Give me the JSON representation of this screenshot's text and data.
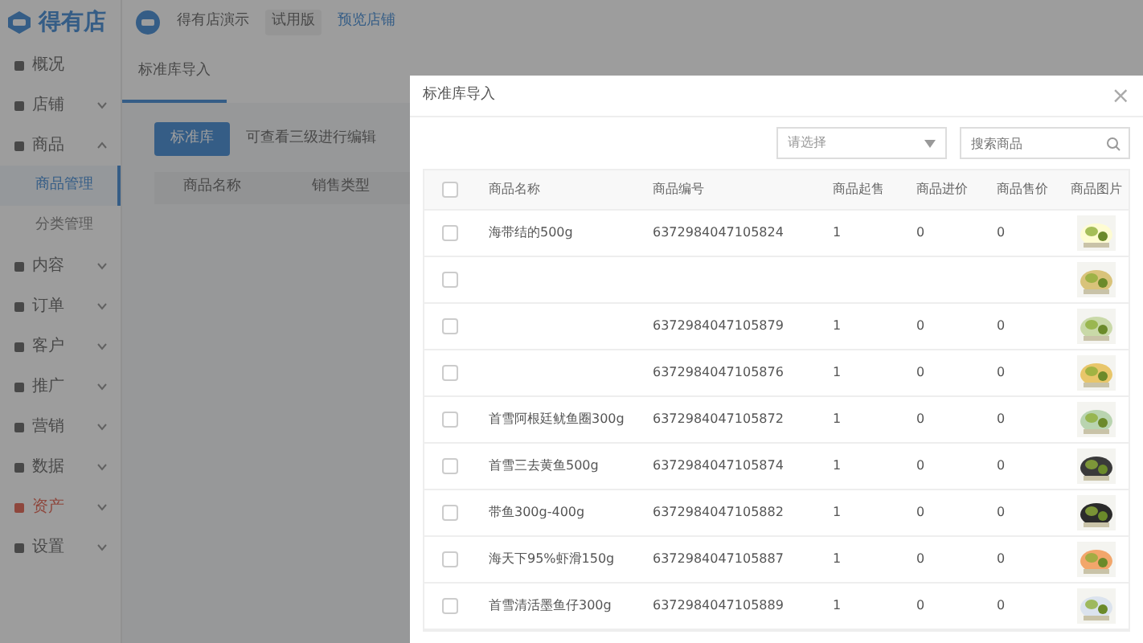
{
  "app": {
    "logo_text": "得有店",
    "store_name": "得有店演示",
    "plan_badge": "试用版",
    "preview_link": "预览店铺"
  },
  "sidebar": {
    "items": [
      {
        "label": "概况",
        "highlighted": false
      },
      {
        "label": "店铺",
        "expanded": false,
        "highlighted": false
      },
      {
        "label": "商品",
        "expanded": true,
        "highlighted": false,
        "children": [
          {
            "label": "商品管理",
            "selected": true
          },
          {
            "label": "分类管理",
            "selected": false
          }
        ]
      },
      {
        "label": "内容",
        "expanded": false,
        "highlighted": false
      },
      {
        "label": "订单",
        "expanded": false,
        "highlighted": false
      },
      {
        "label": "客户",
        "expanded": false,
        "highlighted": false
      },
      {
        "label": "推广",
        "expanded": false,
        "highlighted": false
      },
      {
        "label": "营销",
        "expanded": false,
        "highlighted": false
      },
      {
        "label": "数据",
        "expanded": false,
        "highlighted": false
      },
      {
        "label": "资产",
        "expanded": false,
        "highlighted": true
      },
      {
        "label": "设置",
        "expanded": false,
        "highlighted": false
      }
    ]
  },
  "page": {
    "tabs": [
      {
        "label": "标准库导入",
        "selected": true
      }
    ],
    "button": "标准库",
    "hint": "可查看三级进行编辑",
    "columns": [
      "商品名称",
      "销售类型"
    ]
  },
  "modal": {
    "title": "标准库导入",
    "close": "×",
    "category_select": {
      "placeholder": "请选择"
    },
    "search": {
      "placeholder": "搜索商品"
    },
    "select_all_checked": false,
    "columns": [
      "商品名称",
      "商品编号",
      "商品起售",
      "商品进价",
      "商品售价",
      "商品图片"
    ],
    "rows": [
      {
        "checked": false,
        "name": "海带结的500g",
        "code": "6372984047105824",
        "min": "1",
        "cost": "0",
        "price": "0"
      },
      {
        "checked": false
      },
      {
        "checked": false,
        "code": "6372984047105879",
        "min": "1",
        "cost": "0",
        "price": "0"
      },
      {
        "checked": false,
        "code": "6372984047105876",
        "min": "1",
        "cost": "0",
        "price": "0"
      },
      {
        "checked": false,
        "name": "首雪阿根廷鱿鱼圈300g",
        "code": "6372984047105872",
        "min": "1",
        "cost": "0",
        "price": "0"
      },
      {
        "checked": false,
        "name": "首雪三去黄鱼500g",
        "code": "6372984047105874",
        "min": "1",
        "cost": "0",
        "price": "0"
      },
      {
        "checked": false,
        "name": "带鱼300g-400g",
        "code": "6372984047105882",
        "min": "1",
        "cost": "0",
        "price": "0"
      },
      {
        "checked": false,
        "name": "海天下95%虾滑150g",
        "code": "6372984047105887",
        "min": "1",
        "cost": "0",
        "price": "0"
      },
      {
        "checked": false,
        "name": "首雪清活墨鱼仔300g",
        "code": "6372984047105889",
        "min": "1",
        "cost": "0",
        "price": "0"
      }
    ]
  }
}
